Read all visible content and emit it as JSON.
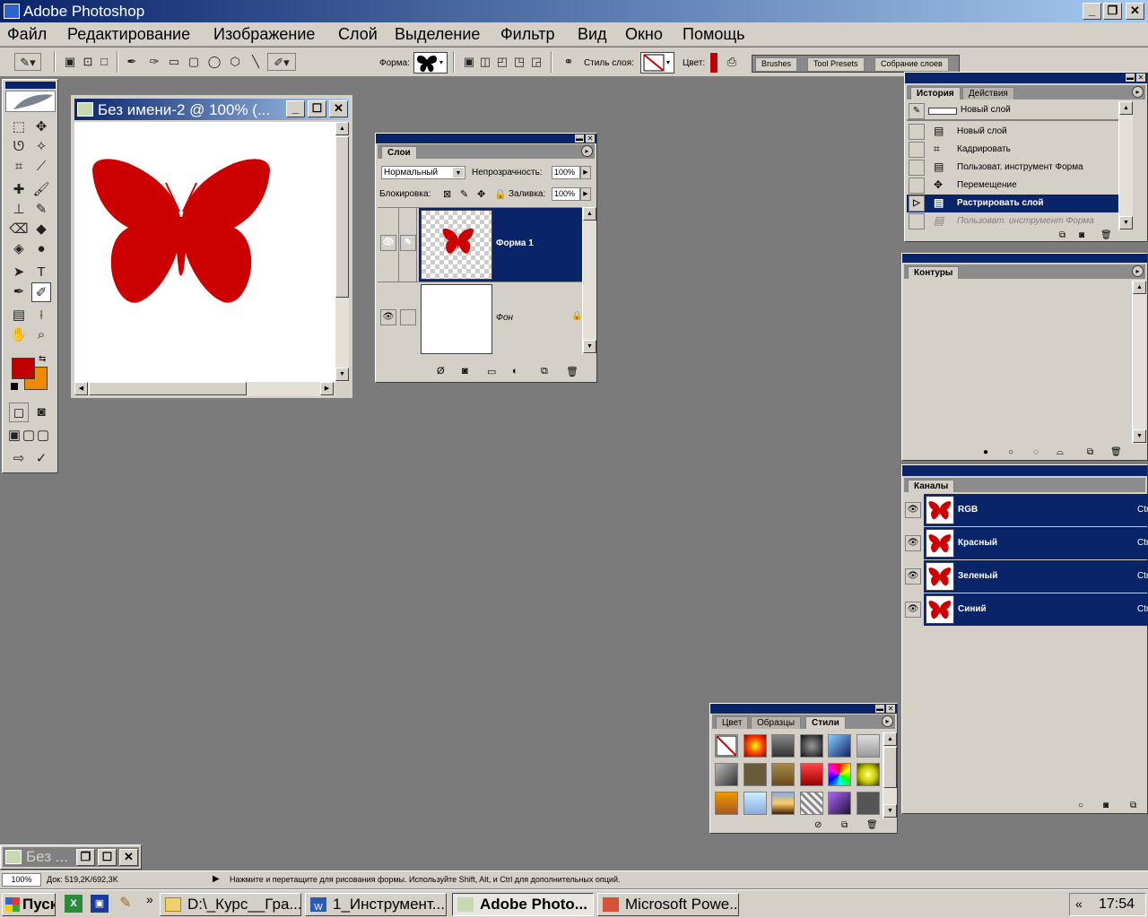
{
  "app": {
    "title": "Adobe Photoshop"
  },
  "menu": [
    "Файл",
    "Редактирование",
    "Изображение",
    "Слой",
    "Выделение",
    "Фильтр",
    "Вид",
    "Окно",
    "Помощь"
  ],
  "options": {
    "shape_label": "Форма:",
    "style_label": "Стиль слоя:",
    "color_label": "Цвет:",
    "tabs": [
      "Brushes",
      "Tool Presets",
      "Собрание слоев"
    ]
  },
  "document": {
    "title": "Без имени-2 @ 100% (...",
    "minimized_title": "Без ..."
  },
  "layers": {
    "title": "Слои",
    "blend_mode": "Нормальный",
    "opacity_label": "Непрозрачность:",
    "opacity": "100%",
    "lock_label": "Блокировка:",
    "fill_label": "Заливка:",
    "fill": "100%",
    "items": [
      {
        "name": "Форма 1",
        "selected": true
      },
      {
        "name": "Фон",
        "selected": false
      }
    ]
  },
  "history": {
    "tabs": [
      "История",
      "Действия"
    ],
    "snapshot": "Новый слой",
    "items": [
      "Новый слой",
      "Кадрировать",
      "Пользоват. инструмент Форма",
      "Перемещение",
      "Растрировать слой",
      "Пользоват. инструмент Форма"
    ],
    "selected_index": 4,
    "greyed_index": 5
  },
  "paths": {
    "title": "Контуры"
  },
  "channels": {
    "title": "Каналы",
    "items": [
      {
        "name": "RGB",
        "shortcut": "Ctr"
      },
      {
        "name": "Красный",
        "shortcut": "Ctr"
      },
      {
        "name": "Зеленый",
        "shortcut": "Ctr"
      },
      {
        "name": "Синий",
        "shortcut": "Ctr"
      }
    ]
  },
  "styles": {
    "tabs": [
      "Цвет",
      "Образцы",
      "Стили"
    ]
  },
  "colors": {
    "foreground": "#c00000",
    "background": "#f08a00",
    "butterfly": "#cc0000",
    "selection": "#0a246a"
  },
  "status": {
    "zoom": "100%",
    "doc": "Док: 519,2K/692,3K",
    "hint": "Нажмите и перетащите для рисования формы. Используйте Shift, Alt, и Ctrl для дополнительных опций."
  },
  "taskbar": {
    "start": "Пуск",
    "buttons": [
      "D:\\_Курс__Гра...",
      "1_Инструмент...",
      "Adobe Photo...",
      "Microsoft Powe..."
    ],
    "chevron": "»",
    "tray_chevron": "«",
    "time": "17:54"
  }
}
